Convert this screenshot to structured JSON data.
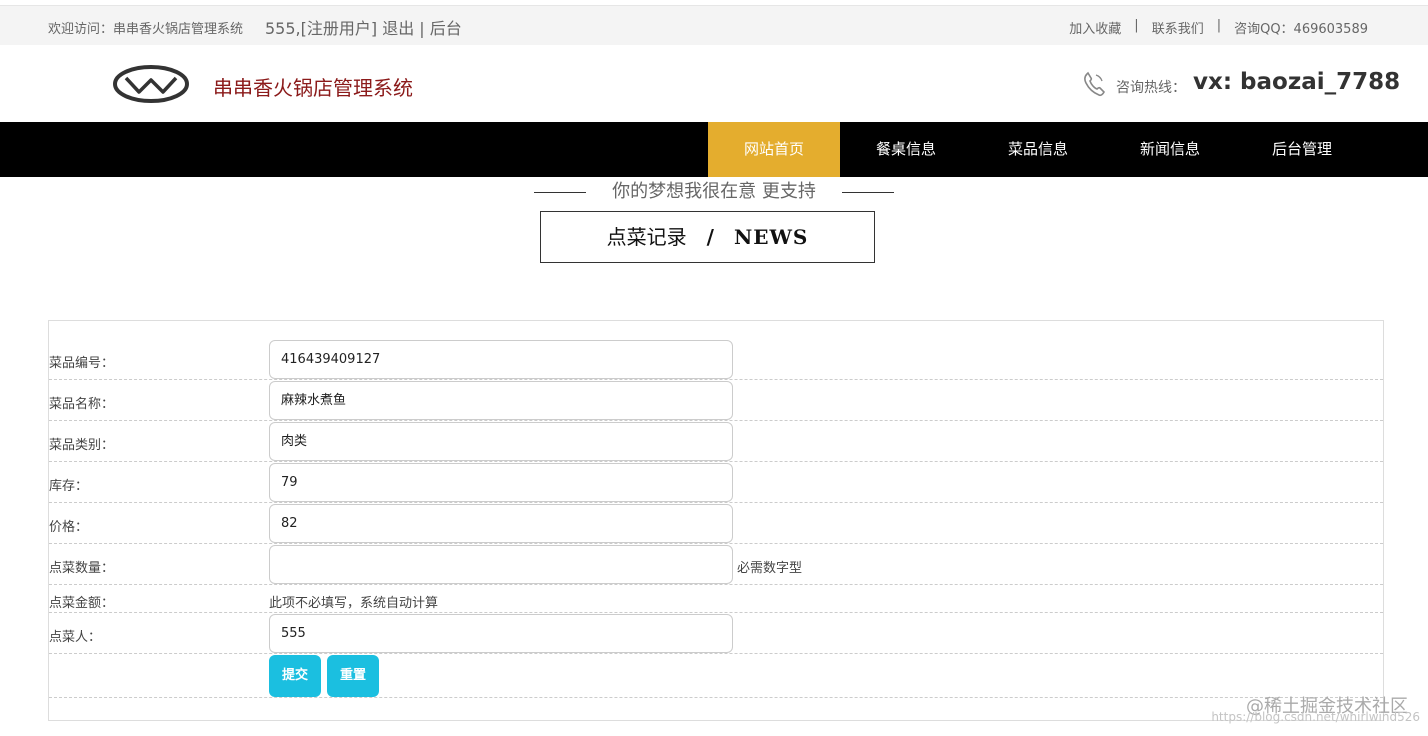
{
  "topbar": {
    "welcome": "欢迎访问：串串香火锅店管理系统",
    "user": "555,[注册用户]  退出  |  后台",
    "favorite": "加入收藏",
    "contact": "联系我们",
    "qq": "咨询QQ：469603589"
  },
  "header": {
    "logo_text": "串串香火锅店管理系统",
    "hotline_label": "咨询热线：",
    "hotline": "vx: baozai_7788"
  },
  "nav": {
    "items": [
      {
        "label": "网站首页",
        "active": true
      },
      {
        "label": "餐桌信息",
        "active": false
      },
      {
        "label": "菜品信息",
        "active": false
      },
      {
        "label": "新闻信息",
        "active": false
      },
      {
        "label": "后台管理",
        "active": false
      }
    ]
  },
  "slogan": "你的梦想我很在意 更支持",
  "section_title": {
    "cn": "点菜记录",
    "slash": "/",
    "en": "NEWS"
  },
  "form": {
    "dish_no_label": "菜品编号：",
    "dish_no_value": "416439409127",
    "dish_name_label": "菜品名称：",
    "dish_name_value": "麻辣水煮鱼",
    "dish_category_label": "菜品类别：",
    "dish_category_value": "肉类",
    "stock_label": "库存：",
    "stock_value": "79",
    "price_label": "价格：",
    "price_value": "82",
    "quantity_label": "点菜数量：",
    "quantity_value": "",
    "quantity_hint": "必需数字型",
    "amount_label": "点菜金额：",
    "amount_hint": "此项不必填写，系统自动计算",
    "orderer_label": "点菜人：",
    "orderer_value": "555",
    "submit_label": "提交",
    "reset_label": "重置"
  },
  "watermark": "@稀土掘金技术社区",
  "watermark_url": "https://blog.csdn.net/whirlwind526"
}
